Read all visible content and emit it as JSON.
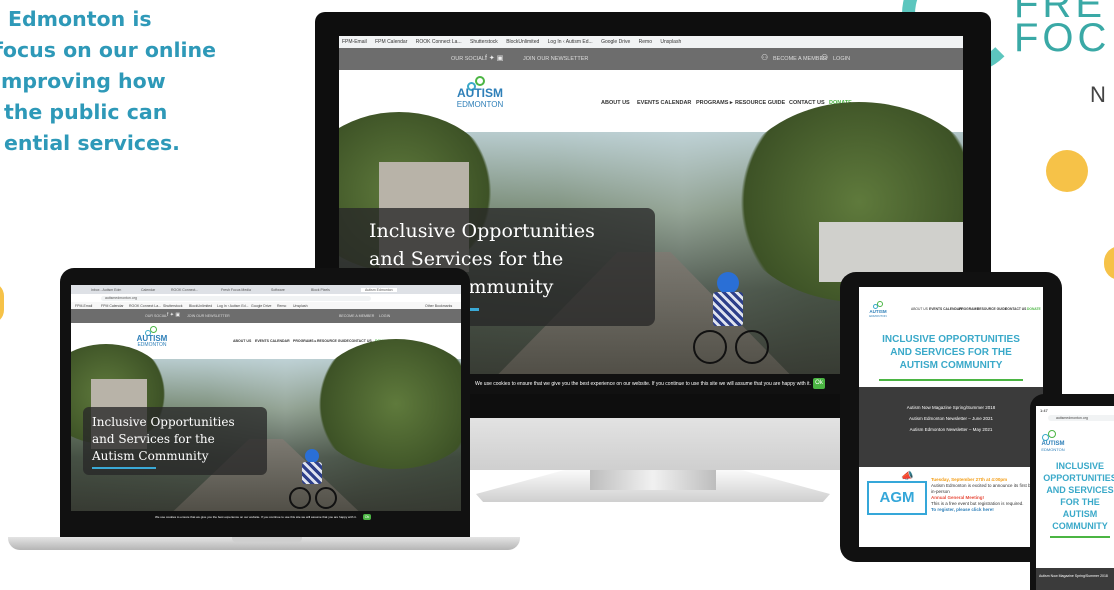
{
  "intro": {
    "lines": [
      "Edmonton is",
      "focus on our online",
      "improving how",
      "the public can",
      "ential services."
    ]
  },
  "brand_logo": {
    "line1": "FRE",
    "line2": "FOC",
    "line3": "N"
  },
  "site": {
    "logo_main": "AUTISM",
    "logo_sub": "EDMONTON",
    "hero_title_lines": [
      "Inclusive Opportunities",
      "and Services for the",
      "Autism Community"
    ],
    "nav": [
      "ABOUT US",
      "EVENTS CALENDAR",
      "PROGRAMS ▸",
      "RESOURCE GUIDE",
      "CONTACT US",
      "DONATE"
    ],
    "our_social": "OUR SOCIAL",
    "newsletter": "JOIN OUR NEWSLETTER",
    "become_member": "BECOME A MEMBER",
    "login": "LOGIN",
    "cookie_text": "We use cookies to ensure that we give you the best experience on our website. If you continue to use this site we will assume that you are happy with it.",
    "cookie_ok": "Ok"
  },
  "monitor": {
    "bookmarks": [
      "FPM-Email",
      "FPM Calendar",
      "ROOK Connect La...",
      "Shutterstock",
      "BlockUnlimited",
      "Log In ‹ Autism Ed...",
      "Google Drive",
      "Remo",
      "Unsplash"
    ]
  },
  "laptop": {
    "tabs": [
      "Inbox - Autism Edm",
      "Calendar",
      "ROOK Connect...",
      "Fresh Focus Media",
      "Software",
      "Block Pixels",
      "Autism Edmonton"
    ],
    "url": "autismedmonton.org",
    "bookmarks": [
      "FPM-Email",
      "FPM Calendar",
      "ROOK Connect La...",
      "Shutterstock",
      "BlockUnlimited",
      "Log In ‹ Autism Ed...",
      "Google Drive",
      "Remo",
      "Unsplash"
    ],
    "other_bookmarks": "Other Bookmarks"
  },
  "tablet": {
    "nav": [
      "ABOUT US",
      "EVENTS CALENDAR",
      "PROGRAMS",
      "RESOURCE GUIDE",
      "CONTACT US",
      "DONATE"
    ],
    "title_lines": [
      "INCLUSIVE OPPORTUNITIES",
      "AND SERVICES FOR THE",
      "AUTISM COMMUNITY"
    ],
    "newsletters": [
      "Autism Now Magazine Spring/Summer 2018",
      "Autism Edmonton Newsletter – June 2021",
      "Autism Edmonton Newsletter – May 2021"
    ],
    "agm_label": "AGM",
    "agm_date": "Tuesday, September 27th at 4:00pm",
    "agm_body": "Autism Edmonton is excited to announce its first back-in-person",
    "agm_highlight": "Annual General Meeting!",
    "agm_body2": "This is a free event but registration is required.",
    "agm_link": "To register, please click here!"
  },
  "phone": {
    "time": "1:47",
    "url": "autismedmonton.org",
    "title_lines": [
      "INCLUSIVE",
      "OPPORTUNITIES",
      "AND SERVICES",
      "FOR THE",
      "AUTISM",
      "COMMUNITY"
    ],
    "footer": "Autism Now Magazine Spring/Summer 2018"
  },
  "colors": {
    "accent_teal": "#2e99b8",
    "donate_green": "#4bb543",
    "logo_yellow": "#f6c248"
  }
}
